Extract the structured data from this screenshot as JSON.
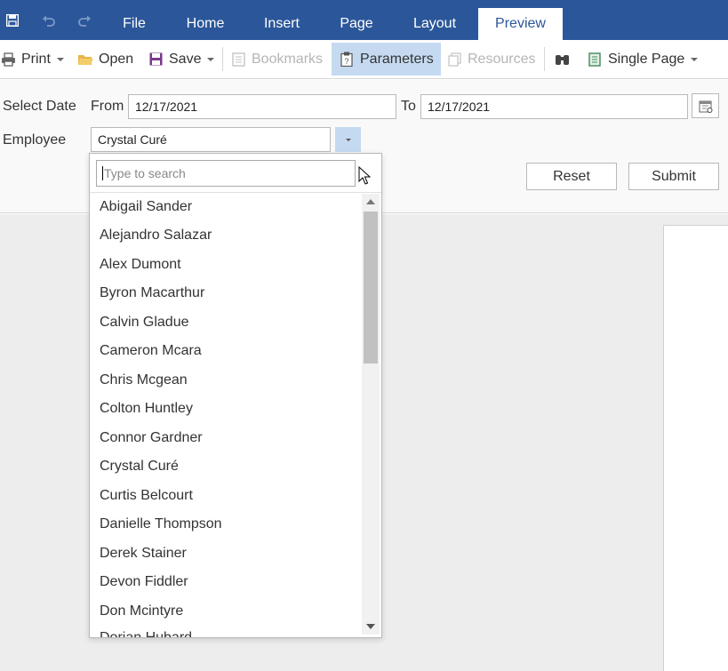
{
  "colors": {
    "ribbon": "#2b579a",
    "accent": "#c5daf1",
    "disabled": "#b5b5b5"
  },
  "ribbon": {
    "quick_access": [
      {
        "icon": "save-icon",
        "enabled": true
      },
      {
        "icon": "undo-icon",
        "enabled": false
      },
      {
        "icon": "redo-icon",
        "enabled": false
      }
    ],
    "tabs": [
      {
        "label": "File",
        "active": false
      },
      {
        "label": "Home",
        "active": false
      },
      {
        "label": "Insert",
        "active": false
      },
      {
        "label": "Page",
        "active": false
      },
      {
        "label": "Layout",
        "active": false
      },
      {
        "label": "Preview",
        "active": true
      }
    ]
  },
  "toolbar": {
    "print": {
      "label": "Print",
      "icon": "printer-icon"
    },
    "open": {
      "label": "Open",
      "icon": "folder-icon"
    },
    "save": {
      "label": "Save",
      "icon": "save-icon"
    },
    "bookmarks": {
      "label": "Bookmarks",
      "icon": "bookmarks-icon",
      "disabled": true
    },
    "parameters": {
      "label": "Parameters",
      "icon": "clipboard-icon",
      "active": true
    },
    "resources": {
      "label": "Resources",
      "icon": "resources-icon",
      "disabled": true
    },
    "find": {
      "icon": "binoculars-icon"
    },
    "view_mode": {
      "label": "Single Page",
      "icon": "page-icon"
    }
  },
  "parameters": {
    "select_date_label": "Select Date",
    "from_label": "From",
    "from_value": "12/17/2021",
    "to_label": "To",
    "to_value": "12/17/2021",
    "employee_label": "Employee",
    "employee_value": "Crystal Curé",
    "reset_label": "Reset",
    "submit_label": "Submit"
  },
  "dropdown": {
    "search_placeholder": "Type to search",
    "items": [
      "Abigail Sander",
      "Alejandro Salazar",
      "Alex Dumont",
      "Byron Macarthur",
      "Calvin Gladue",
      "Cameron Mcara",
      "Chris Mcgean",
      "Colton Huntley",
      "Connor Gardner",
      "Crystal Curé",
      "Curtis Belcourt",
      "Danielle Thompson",
      "Derek Stainer",
      "Devon Fiddler",
      "Don Mcintyre",
      "Dorian Hubard"
    ]
  }
}
